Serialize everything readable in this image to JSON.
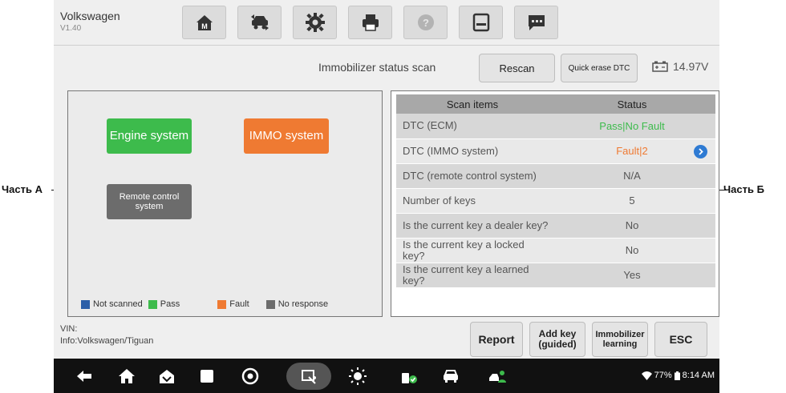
{
  "callouts": {
    "part_a": "Часть А",
    "part_b": "Часть Б"
  },
  "app": {
    "name": "Volkswagen",
    "version": "V1.40"
  },
  "toolbar": {
    "buttons": [
      "home-icon",
      "vehicle-swap-icon",
      "settings-gear-icon",
      "printer-icon",
      "help-icon",
      "save-icon",
      "message-icon"
    ]
  },
  "status": {
    "scan_title": "Immobilizer status scan",
    "rescan_label": "Rescan",
    "quick_erase_label": "Quick erase DTC",
    "voltage": "14.97V"
  },
  "systems": {
    "engine": "Engine system",
    "immo": "IMMO system",
    "remote": "Remote control system"
  },
  "legend": {
    "not_scanned": "Not scanned",
    "pass": "Pass",
    "fault": "Fault",
    "no_response": "No response",
    "colors": {
      "not_scanned": "#2b5fa8",
      "pass": "#3dbb4c",
      "fault": "#ef7a32",
      "no_response": "#6c6c6c"
    }
  },
  "table": {
    "headers": {
      "item": "Scan items",
      "status": "Status"
    },
    "rows": [
      {
        "item": "DTC (ECM)",
        "status": "Pass|No Fault",
        "color": "#3dbb4c"
      },
      {
        "item": "DTC (IMMO system)",
        "status": "Fault|2",
        "color": "#ef7a32"
      },
      {
        "item": "DTC (remote control system)",
        "status": "N/A",
        "color": "#555555"
      },
      {
        "item": "Number of keys",
        "status": "5",
        "color": "#555555"
      },
      {
        "item": "Is the current key a dealer key?",
        "status": "No",
        "color": "#555555"
      },
      {
        "item": "Is the current key a locked key?",
        "status": "No",
        "color": "#555555"
      },
      {
        "item": "Is the current key a learned key?",
        "status": "Yes",
        "color": "#555555"
      }
    ]
  },
  "info": {
    "vin_label": "VIN:",
    "info_text": "Info:Volkswagen/Tiguan",
    "report_label": "Report",
    "add_key_label": "Add key (guided)",
    "immo_learning_label": "Immobilizer learning",
    "esc_label": "ESC"
  },
  "system_bar": {
    "battery": "77%",
    "time": "8:14 AM"
  }
}
